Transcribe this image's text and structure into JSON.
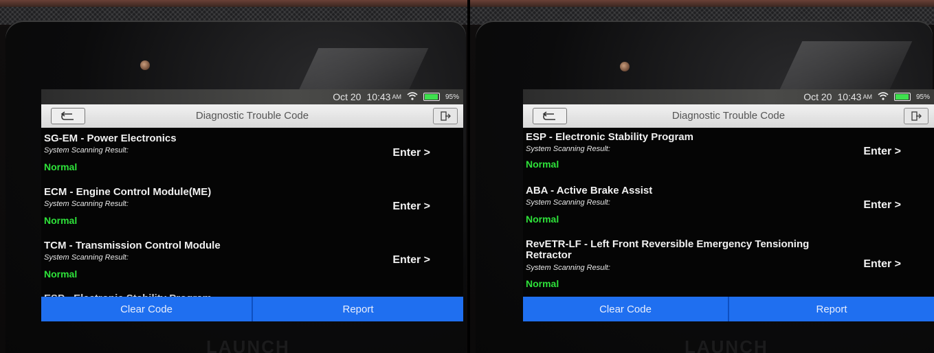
{
  "panels": [
    {
      "status": {
        "date": "Oct 20",
        "time": "10:43",
        "ampm": "AM",
        "battery": "95%"
      },
      "title": "Diagnostic Trouble Code",
      "items": [
        {
          "name": "SG-EM - Power Electronics",
          "sub": "System Scanning Result:",
          "status": "Normal",
          "enter": "Enter >"
        },
        {
          "name": "ECM - Engine Control Module(ME)",
          "sub": "System Scanning Result:",
          "status": "Normal",
          "enter": "Enter >"
        },
        {
          "name": "TCM - Transmission Control Module",
          "sub": "System Scanning Result:",
          "status": "Normal",
          "enter": "Enter >"
        }
      ],
      "partial_item": "ESP - Electronic Stability Program",
      "buttons": {
        "clear": "Clear Code",
        "report": "Report"
      },
      "brand": "LAUNCH"
    },
    {
      "status": {
        "date": "Oct 20",
        "time": "10:43",
        "ampm": "AM",
        "battery": "95%"
      },
      "title": "Diagnostic Trouble Code",
      "items": [
        {
          "name": "ESP - Electronic Stability Program",
          "sub": "System Scanning Result:",
          "status": "Normal",
          "enter": "Enter >"
        },
        {
          "name": "ABA - Active Brake Assist",
          "sub": "System Scanning Result:",
          "status": "Normal",
          "enter": "Enter >"
        },
        {
          "name": "RevETR-LF - Left Front Reversible Emergency Tensioning Retractor",
          "sub": "System Scanning Result:",
          "status": "Normal",
          "enter": "Enter >"
        }
      ],
      "buttons": {
        "clear": "Clear Code",
        "report": "Report"
      },
      "brand": "LAUNCH"
    }
  ],
  "colors": {
    "status_normal": "#2ee23a",
    "button_bar": "#1f6ff0",
    "titlebar": "#e4e4e4"
  },
  "icons": {
    "back": "back-arrow-icon",
    "exit": "exit-icon",
    "wifi": "wifi-icon",
    "battery": "battery-icon"
  }
}
